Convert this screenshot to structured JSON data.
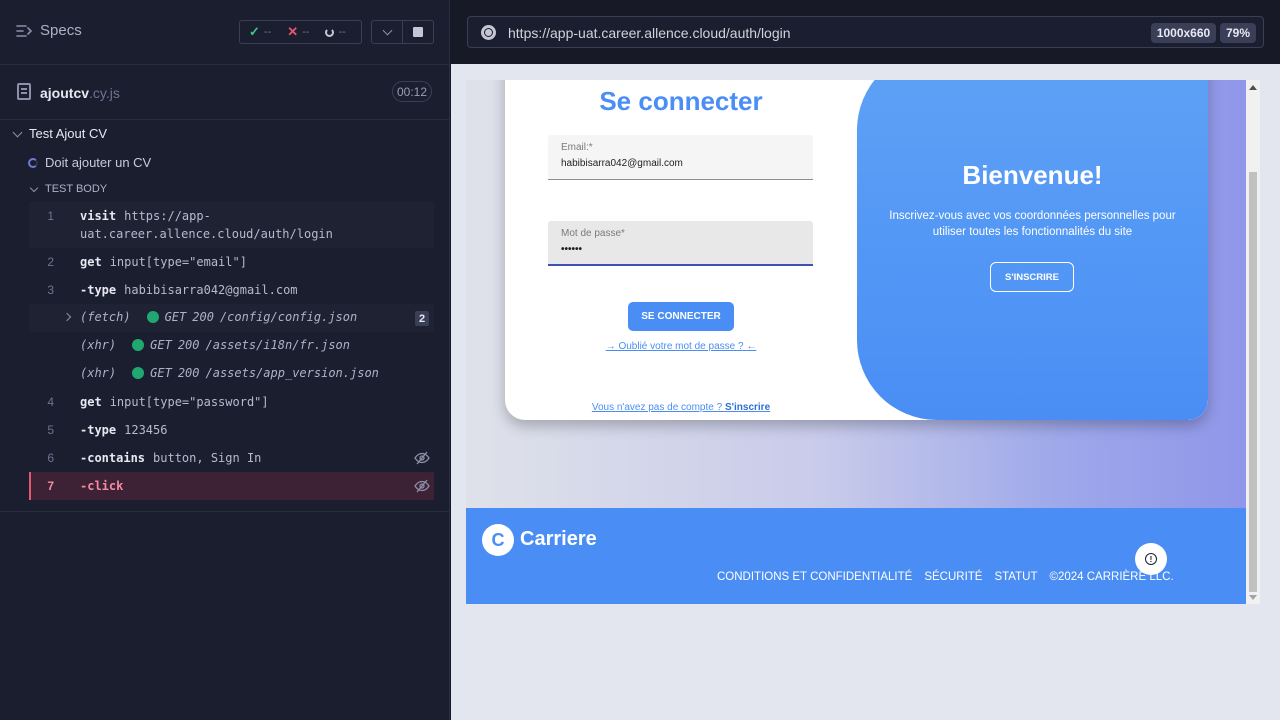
{
  "reporter": {
    "specs_label": "Specs",
    "stats": {
      "passed": "--",
      "failed": "--",
      "pending": "--"
    },
    "file": {
      "base": "ajoutcv",
      "ext": ".cy.js",
      "duration": "00:12"
    },
    "suite_title": "Test Ajout CV",
    "test_title": "Doit ajouter un CV",
    "body_label": "TEST BODY",
    "commands": [
      {
        "num": "1",
        "name": "visit",
        "msg_line1": "https://app-",
        "msg_line2": "uat.career.allence.cloud/auth/login"
      },
      {
        "num": "2",
        "name": "get",
        "msg": "input[type=\"email\"]"
      },
      {
        "num": "3",
        "name": "-type",
        "msg": "habibisarra042@gmail.com"
      },
      {
        "tag": "(fetch)",
        "method": "GET",
        "status": "200",
        "url": "/config/config.json",
        "count": "2"
      },
      {
        "tag": "(xhr)",
        "method": "GET",
        "status": "200",
        "url": "/assets/i18n/fr.json"
      },
      {
        "tag": "(xhr)",
        "method": "GET",
        "status": "200",
        "url": "/assets/app_version.json"
      },
      {
        "num": "4",
        "name": "get",
        "msg": "input[type=\"password\"]"
      },
      {
        "num": "5",
        "name": "-type",
        "msg": "123456"
      },
      {
        "num": "6",
        "name": "-contains",
        "msg": "button, Sign In"
      },
      {
        "num": "7",
        "name": "-click",
        "msg": ""
      }
    ]
  },
  "aut": {
    "url": "https://app-uat.career.allence.cloud/auth/login",
    "viewport_size": "1000x660",
    "zoom": "79%",
    "page": {
      "login_title": "Se connecter",
      "email_label": "Email:*",
      "email_value": "habibisarra042@gmail.com",
      "password_label": "Mot de passe*",
      "password_value": "••••••",
      "login_button": "SE CONNECTER",
      "forgot_link": "→ Oublié votre mot de passe ? ←",
      "no_account_text": "Vous n'avez pas de compte ? ",
      "no_account_link": "S'inscrire",
      "welcome_title": "Bienvenue!",
      "welcome_text": "Inscrivez-vous avec vos coordonnées personnelles pour utiliser toutes les fonctionnalités du site",
      "signup_button": "S'INSCRIRE",
      "footer_logo_letter": "C",
      "footer_brand": "Carriere",
      "footer_links": [
        "CONDITIONS ET CONFIDENTIALITÉ",
        "SÉCURITÉ",
        "STATUT",
        "©2024 CARRIÈRE LLC."
      ]
    }
  },
  "colors": {
    "brand_blue": "#4a8ef5",
    "pass_green": "#1fa971",
    "fail_red": "#e45770",
    "active_row": "#3d2236"
  }
}
